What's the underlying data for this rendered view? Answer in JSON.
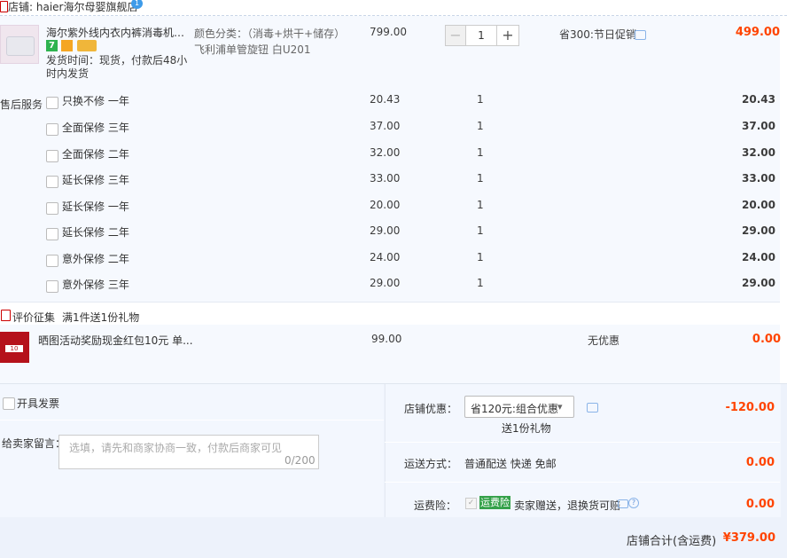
{
  "shop": {
    "name": "店铺: haier海尔母婴旗舰店",
    "badge": "1"
  },
  "item": {
    "title": "海尔紫外线内衣内裤消毒机家用...",
    "icon_7": "7",
    "shipping_note": "发货时间：现货，付款后48小时内发货",
    "spec_color": "颜色分类：（消毒+烘干+储存）",
    "spec_model": "飞利浦单管旋钮 白U201",
    "unit_price": "799.00",
    "qty_minus": "−",
    "qty": "1",
    "qty_plus": "+",
    "promo": "省300:节日促销",
    "subtotal": "499.00"
  },
  "services": {
    "label": "售后服务",
    "rows": [
      {
        "name": "只换不修 一年",
        "price": "20.43",
        "qty": "1",
        "sum": "20.43"
      },
      {
        "name": "全面保修 三年",
        "price": "37.00",
        "qty": "1",
        "sum": "37.00"
      },
      {
        "name": "全面保修 二年",
        "price": "32.00",
        "qty": "1",
        "sum": "32.00"
      },
      {
        "name": "延长保修 三年",
        "price": "33.00",
        "qty": "1",
        "sum": "33.00"
      },
      {
        "name": "延长保修 一年",
        "price": "20.00",
        "qty": "1",
        "sum": "20.00"
      },
      {
        "name": "延长保修 二年",
        "price": "29.00",
        "qty": "1",
        "sum": "29.00"
      },
      {
        "name": "意外保修 二年",
        "price": "24.00",
        "qty": "1",
        "sum": "24.00"
      },
      {
        "name": "意外保修 三年",
        "price": "29.00",
        "qty": "1",
        "sum": "29.00"
      }
    ]
  },
  "gift": {
    "label": "评价征集",
    "rule": "满1件送1份礼物",
    "title": "晒图活动奖励现金红包10元 单...",
    "price": "99.00",
    "no_discount": "无优惠",
    "sum": "0.00"
  },
  "invoice": {
    "label": "开具发票"
  },
  "message": {
    "label": "给卖家留言：",
    "placeholder": "选填，请先和商家协商一致，付款后商家可见",
    "count": "0/200"
  },
  "discount": {
    "label": "店铺优惠：",
    "selected": "省120元:组合优惠",
    "arrow": "▾",
    "gift_note": "送1份礼物",
    "amount": "-120.00"
  },
  "shipping": {
    "label": "运送方式：",
    "method": "普通配送 快递 免邮",
    "amount": "0.00"
  },
  "insurance": {
    "label": "运费险：",
    "check": "✓",
    "badge": "运费险",
    "desc": "卖家赠送，退换货可赔",
    "help": "?",
    "amount": "0.00"
  },
  "total": {
    "label": "店铺合计(含运费)",
    "value": "¥379.00"
  },
  "colors": {
    "price_red": "#ff4400",
    "panel_bg": "#f3f7fe",
    "accent_blue": "#3e9be9",
    "insurance_green": "#35a14a"
  }
}
